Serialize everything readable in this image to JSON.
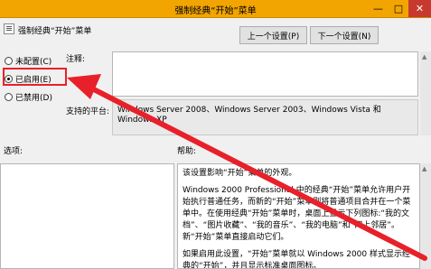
{
  "window": {
    "title": "强制经典“开始”菜单",
    "minimize": "—",
    "maximize": "□",
    "close": "✕"
  },
  "header": {
    "policy_name": "强制经典“开始”菜单",
    "prev_button": "上一个设置(P)",
    "next_button": "下一个设置(N)"
  },
  "options": {
    "not_configured": "未配置(C)",
    "enabled": "已启用(E)",
    "disabled": "已禁用(D)",
    "selected": "enabled"
  },
  "labels": {
    "comment": "注释:",
    "platform": "支持的平台:",
    "options": "选项:",
    "help": "帮助:"
  },
  "platform_text": "Windows Server 2008、Windows Server 2003、Windows Vista 和 Windows XP",
  "help": {
    "p1": "该设置影响“开始”菜单的外观。",
    "p2": "Windows 2000 Professional 中的经典“开始”菜单允许用户开始执行普通任务，而新的“开始”菜单则将普通项目合并在一个菜单中。在使用经典“开始”菜单时，桌面上显示下列图标:“我的文档”、“图片收藏”、“我的音乐”、“我的电脑”和“网上邻居”。新“开始”菜单直接启动它们。",
    "p3": "如果启用此设置，“开始”菜单就以 Windows 2000 样式显示经典的“开始”，并且显示标准桌面图标。"
  },
  "colors": {
    "titlebar": "#f2a500",
    "close": "#c7392f",
    "annotation": "#e8202a"
  }
}
